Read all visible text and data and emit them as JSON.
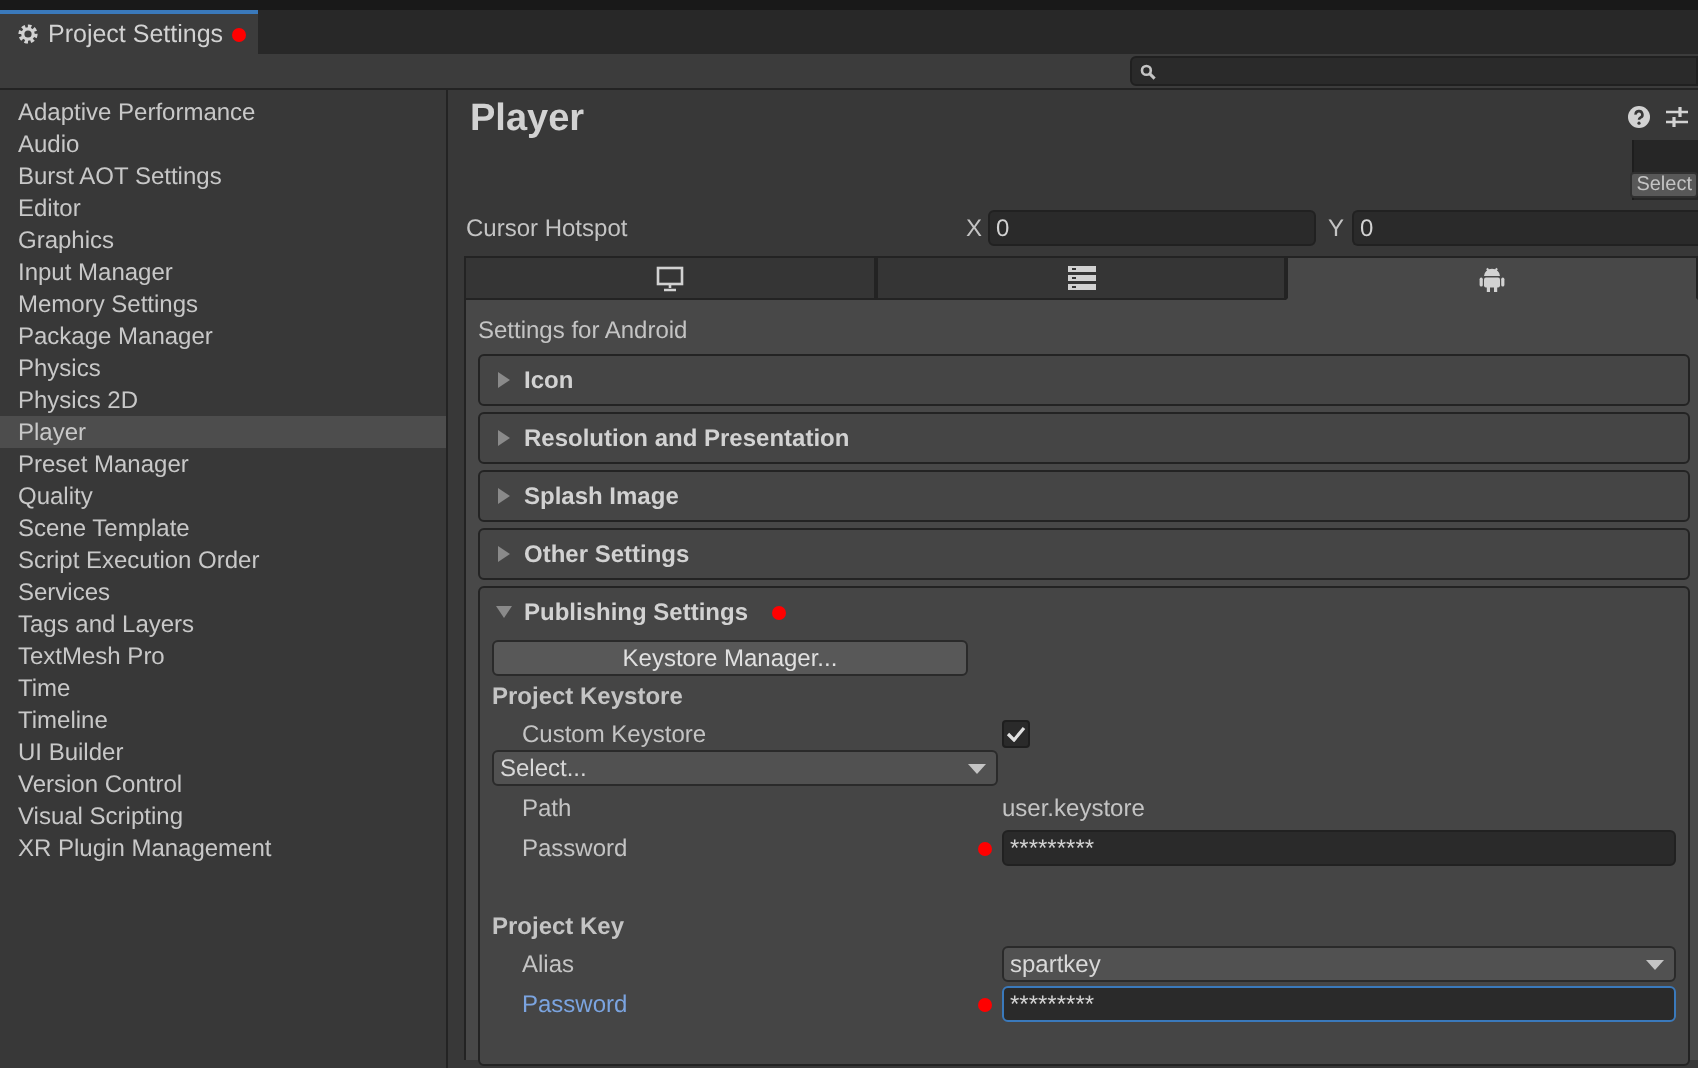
{
  "window": {
    "title": "Project Settings",
    "modified": true
  },
  "sidebar": {
    "items": [
      {
        "label": "Adaptive Performance",
        "selected": false
      },
      {
        "label": "Audio",
        "selected": false
      },
      {
        "label": "Burst AOT Settings",
        "selected": false
      },
      {
        "label": "Editor",
        "selected": false
      },
      {
        "label": "Graphics",
        "selected": false
      },
      {
        "label": "Input Manager",
        "selected": false
      },
      {
        "label": "Memory Settings",
        "selected": false
      },
      {
        "label": "Package Manager",
        "selected": false
      },
      {
        "label": "Physics",
        "selected": false
      },
      {
        "label": "Physics 2D",
        "selected": false
      },
      {
        "label": "Player",
        "selected": true
      },
      {
        "label": "Preset Manager",
        "selected": false
      },
      {
        "label": "Quality",
        "selected": false
      },
      {
        "label": "Scene Template",
        "selected": false
      },
      {
        "label": "Script Execution Order",
        "selected": false
      },
      {
        "label": "Services",
        "selected": false
      },
      {
        "label": "Tags and Layers",
        "selected": false
      },
      {
        "label": "TextMesh Pro",
        "selected": false
      },
      {
        "label": "Time",
        "selected": false
      },
      {
        "label": "Timeline",
        "selected": false
      },
      {
        "label": "UI Builder",
        "selected": false
      },
      {
        "label": "Version Control",
        "selected": false
      },
      {
        "label": "Visual Scripting",
        "selected": false
      },
      {
        "label": "XR Plugin Management",
        "selected": false
      }
    ]
  },
  "page": {
    "title": "Player"
  },
  "preview": {
    "button": "Select"
  },
  "cursor_hotspot": {
    "label": "Cursor Hotspot",
    "x_label": "X",
    "x_value": "0",
    "y_label": "Y",
    "y_value": "0"
  },
  "platform_tabs": [
    {
      "kind": "desktop",
      "selected": false
    },
    {
      "kind": "server",
      "selected": false
    },
    {
      "kind": "android",
      "selected": true
    }
  ],
  "settings_heading": "Settings for Android",
  "sections": [
    {
      "title": "Icon",
      "expanded": false,
      "modified": false
    },
    {
      "title": "Resolution and Presentation",
      "expanded": false,
      "modified": false
    },
    {
      "title": "Splash Image",
      "expanded": false,
      "modified": false
    },
    {
      "title": "Other Settings",
      "expanded": false,
      "modified": false
    },
    {
      "title": "Publishing Settings",
      "expanded": true,
      "modified": true
    }
  ],
  "publishing": {
    "keystore_manager_button": "Keystore Manager...",
    "project_keystore": {
      "heading": "Project Keystore",
      "custom_keystore": {
        "label": "Custom Keystore",
        "checked": true
      },
      "dropdown": "Select...",
      "path": {
        "label": "Path",
        "value": "user.keystore"
      },
      "password": {
        "label": "Password",
        "value": "*********",
        "modified": true,
        "focused": false
      }
    },
    "project_key": {
      "heading": "Project Key",
      "alias": {
        "label": "Alias",
        "value": "spartkey"
      },
      "password": {
        "label": "Password",
        "value": "*********",
        "modified": true,
        "focused": true
      }
    }
  }
}
